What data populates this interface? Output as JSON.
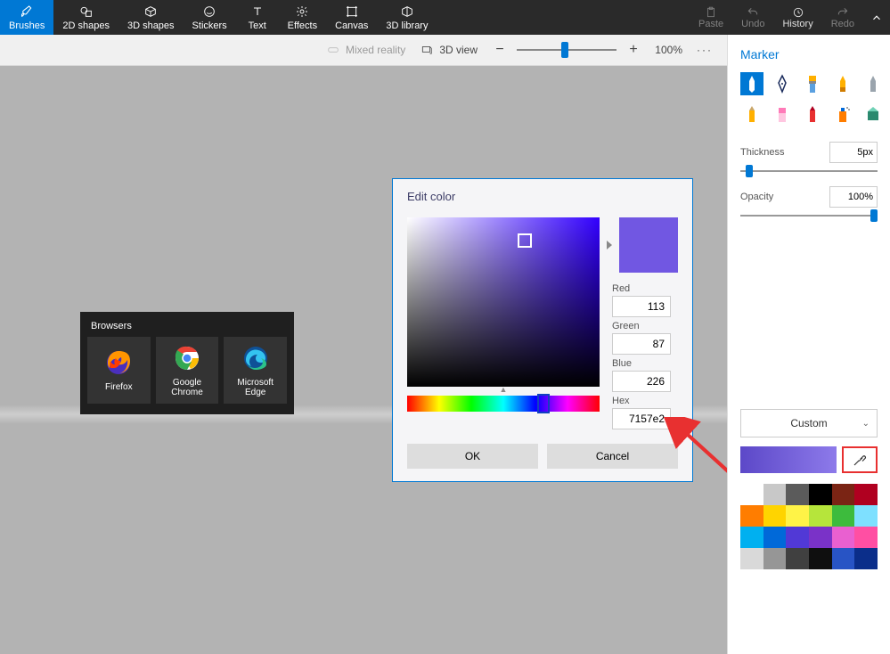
{
  "topbar": {
    "tabs": [
      {
        "label": "Brushes"
      },
      {
        "label": "2D shapes"
      },
      {
        "label": "3D shapes"
      },
      {
        "label": "Stickers"
      },
      {
        "label": "Text"
      },
      {
        "label": "Effects"
      },
      {
        "label": "Canvas"
      },
      {
        "label": "3D library"
      }
    ],
    "right": {
      "paste": "Paste",
      "undo": "Undo",
      "history": "History",
      "redo": "Redo"
    }
  },
  "secbar": {
    "mixed": "Mixed reality",
    "view3d": "3D view",
    "zoom_pct": "100%"
  },
  "browsers": {
    "title": "Browsers",
    "apps": [
      {
        "name": "Firefox"
      },
      {
        "name": "Google Chrome"
      },
      {
        "name": "Microsoft Edge"
      }
    ]
  },
  "dialog": {
    "title": "Edit color",
    "red_label": "Red",
    "red": "113",
    "green_label": "Green",
    "green": "87",
    "blue_label": "Blue",
    "blue": "226",
    "hex_label": "Hex",
    "hex": "7157e2",
    "ok": "OK",
    "cancel": "Cancel"
  },
  "panel": {
    "title": "Marker",
    "thickness_label": "Thickness",
    "thickness": "5px",
    "opacity_label": "Opacity",
    "opacity": "100%",
    "custom": "Custom"
  },
  "palette": [
    "#ffffff",
    "#c8c8c8",
    "#5b5b5b",
    "#000000",
    "#7a2414",
    "#b00020",
    "#ff7d00",
    "#ffd400",
    "#fff347",
    "#b6e53b",
    "#3dbb3d",
    "#7ee0ff",
    "#00b0f0",
    "#0069d9",
    "#5139d6",
    "#7a32c8",
    "#e960d0",
    "#ff4fa3"
  ],
  "gray_palette": [
    "#d9d9d9",
    "#969696",
    "#404040",
    "#0f0f0f",
    "#2854c5",
    "#0b2e8a"
  ]
}
